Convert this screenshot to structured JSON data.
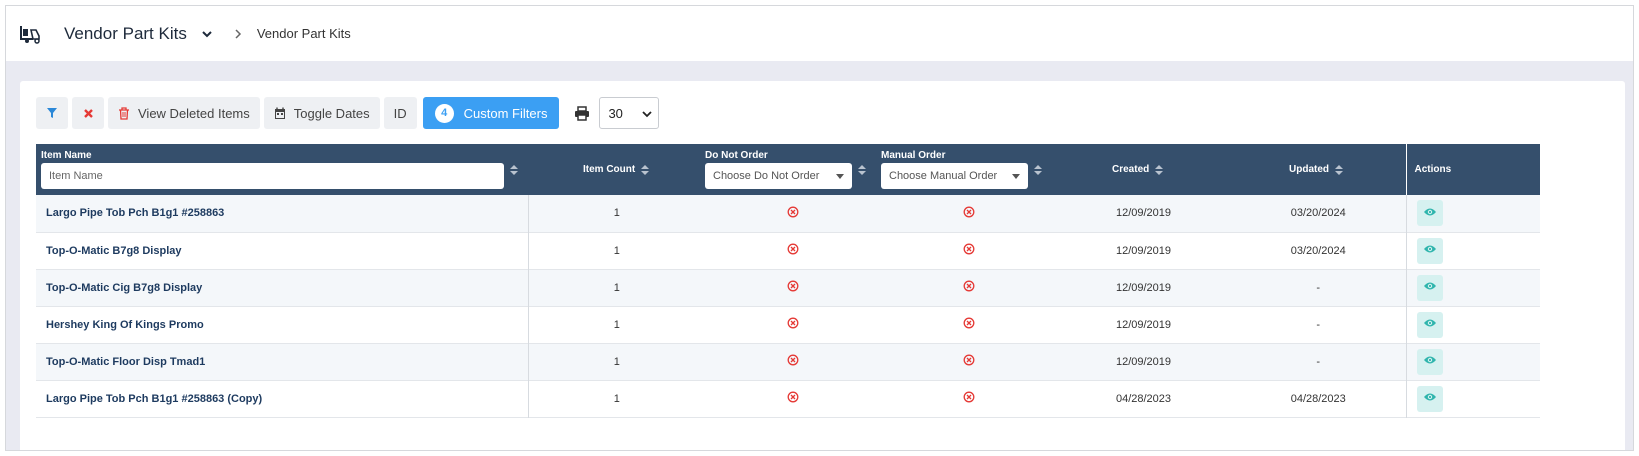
{
  "header": {
    "logo_icon": "forklift-icon",
    "title": "Vendor Part Kits",
    "breadcrumb": "Vendor Part Kits"
  },
  "toolbar": {
    "view_deleted_label": "View Deleted Items",
    "toggle_dates_label": "Toggle Dates",
    "id_label": "ID",
    "custom_filters_count": "4",
    "custom_filters_label": "Custom Filters",
    "page_size": "30"
  },
  "table": {
    "headers": {
      "item_name": "Item Name",
      "item_count": "Item Count",
      "do_not_order": "Do Not Order",
      "manual_order": "Manual Order",
      "created": "Created",
      "updated": "Updated",
      "actions": "Actions"
    },
    "filters": {
      "item_name_placeholder": "Item Name",
      "do_not_order_placeholder": "Choose Do Not Order",
      "manual_order_placeholder": "Choose Manual Order"
    },
    "rows": [
      {
        "name": "Largo Pipe Tob Pch B1g1 #258863",
        "count": "1",
        "created": "12/09/2019",
        "updated": "03/20/2024"
      },
      {
        "name": "Top-O-Matic B7g8 Display",
        "count": "1",
        "created": "12/09/2019",
        "updated": "03/20/2024"
      },
      {
        "name": "Top-O-Matic Cig B7g8 Display",
        "count": "1",
        "created": "12/09/2019",
        "updated": "-"
      },
      {
        "name": "Hershey King Of Kings Promo",
        "count": "1",
        "created": "12/09/2019",
        "updated": "-"
      },
      {
        "name": "Top-O-Matic Floor Disp Tmad1",
        "count": "1",
        "created": "12/09/2019",
        "updated": "-"
      },
      {
        "name": "Largo Pipe Tob Pch B1g1 #258863 (Copy)",
        "count": "1",
        "created": "04/28/2023",
        "updated": "04/28/2023"
      }
    ]
  },
  "colors": {
    "header_bg": "#354f6c",
    "primary": "#3b9ff3",
    "danger": "#e53935",
    "teal": "#2fb5ad"
  }
}
